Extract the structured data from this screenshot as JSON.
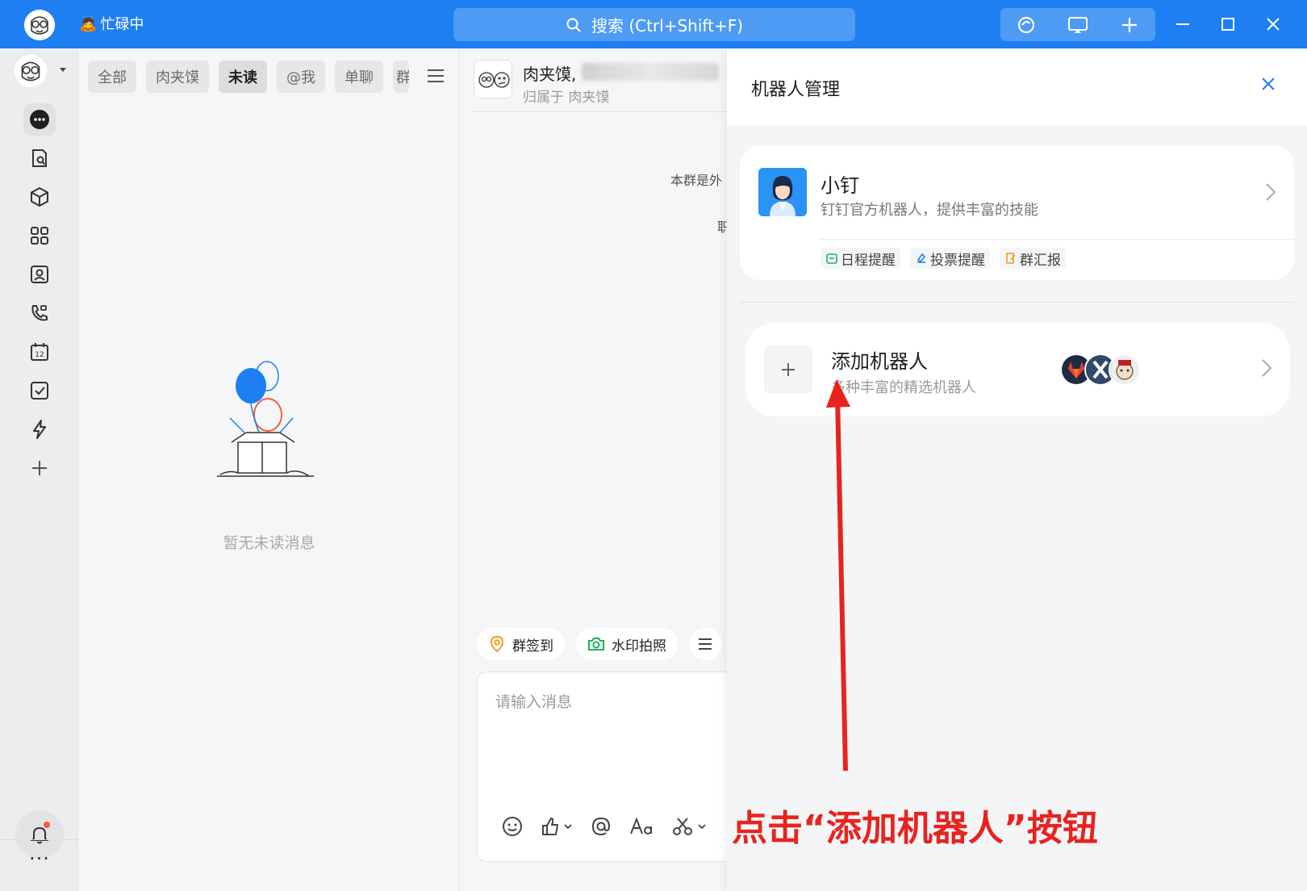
{
  "titlebar": {
    "status": "忙碌中",
    "search_label": "搜索 (Ctrl+Shift+F)"
  },
  "convlist": {
    "tabs": [
      "全部",
      "肉夹馍",
      "未读",
      "@我",
      "单聊",
      "群"
    ],
    "active_tab": "未读",
    "empty_text": "暂无未读消息"
  },
  "chat": {
    "title": "肉夹馍,",
    "subtitle": "归属于 肉夹馍",
    "notice": "本群是外",
    "notice2": "职",
    "quick_actions": [
      "群签到",
      "水印拍照"
    ],
    "input_placeholder": "请输入消息"
  },
  "panel": {
    "title": "机器人管理",
    "bot": {
      "name": "小钉",
      "desc": "钉钉官方机器人，提供丰富的技能",
      "skills": [
        "日程提醒",
        "投票提醒",
        "群汇报"
      ]
    },
    "add": {
      "name": "添加机器人",
      "desc": "多种丰富的精选机器人"
    }
  },
  "annotation": {
    "text": "点击“添加机器人”按钮"
  },
  "colors": {
    "brand": "#1d7ff2",
    "annotation": "#e8231f"
  }
}
